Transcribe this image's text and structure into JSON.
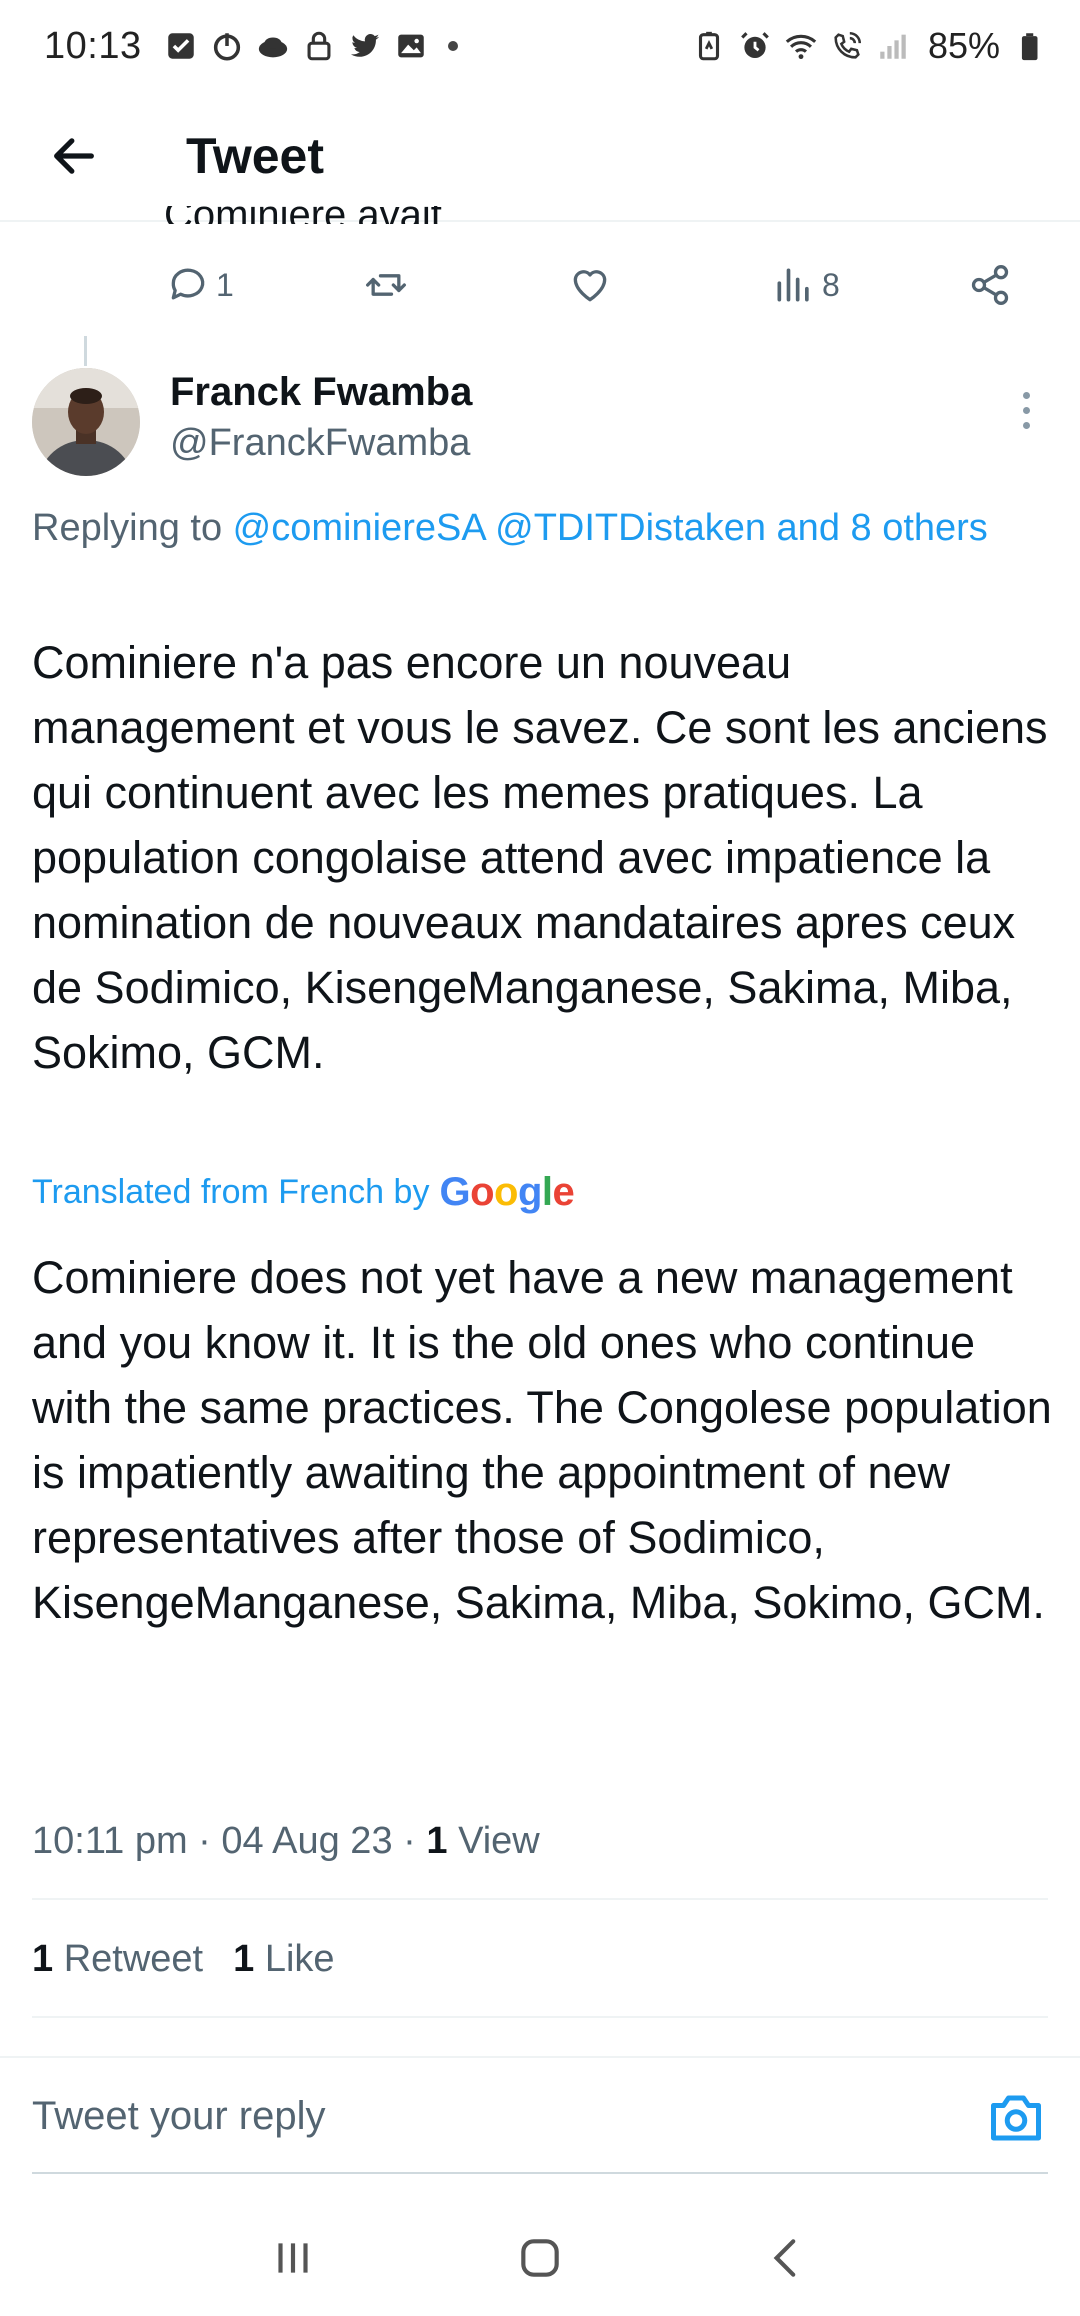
{
  "status_bar": {
    "time": "10:13",
    "battery": "85%"
  },
  "header": {
    "title": "Tweet"
  },
  "previous_tweet": {
    "cut_text": "Cominiere avait",
    "reply_count": "1",
    "view_count": "8"
  },
  "author": {
    "name": "Franck Fwamba",
    "handle": "@FranckFwamba"
  },
  "replying": {
    "prefix": "Replying to ",
    "mention1": "@cominiereSA",
    "mention2": "@TDITDistaken",
    "others": "and 8 others"
  },
  "tweet": {
    "text": "Cominiere n'a pas encore un nouveau management et vous le savez. Ce sont les anciens qui continuent avec les memes pratiques. La population congolaise attend avec impatience la nomination de nouveaux mandataires apres ceux de Sodimico, KisengeManganese, Sakima, Miba, Sokimo, GCM.",
    "translated_label": "Translated from French by",
    "translation": "Cominiere does not yet have a new management and you know it. It is the old ones who continue with the same practices. The Congolese population is impatiently awaiting the appointment of new representatives after those of Sodimico, KisengeManganese, Sakima, Miba, Sokimo, GCM.",
    "time": "10:11 pm",
    "date": "04 Aug 23",
    "views_count": "1",
    "views_label": "View",
    "retweets_count": "1",
    "retweets_label": "Retweet",
    "likes_count": "1",
    "likes_label": "Like"
  },
  "reply_box": {
    "placeholder": "Tweet your reply"
  },
  "colors": {
    "accent": "#1d9bf0",
    "text": "#0f1419",
    "secondary": "#536471"
  },
  "icons": [
    "back-arrow-icon",
    "reply-icon",
    "retweet-icon",
    "like-icon",
    "views-icon",
    "share-icon",
    "more-icon",
    "camera-icon"
  ]
}
